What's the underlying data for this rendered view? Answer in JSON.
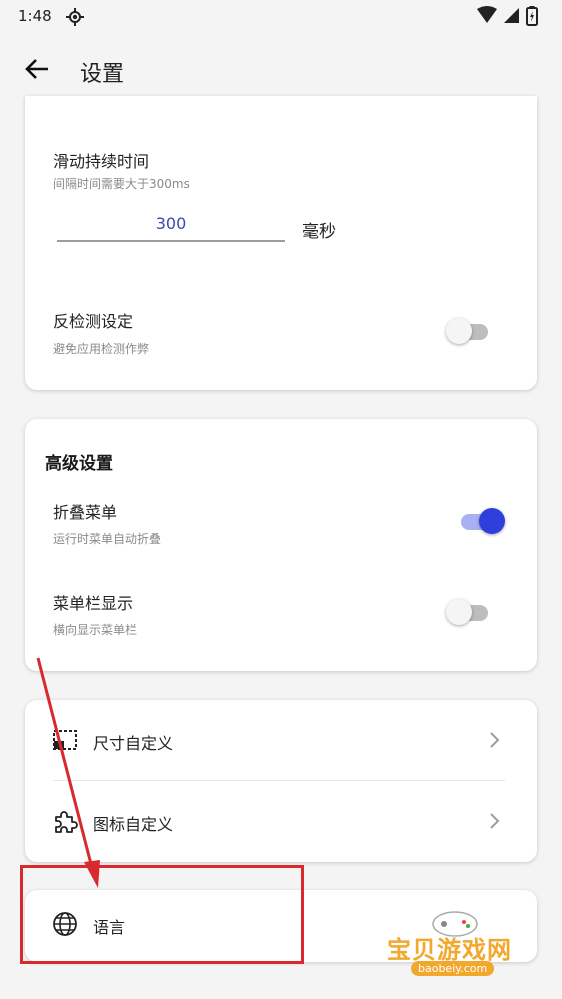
{
  "status_bar": {
    "time": "1:48"
  },
  "app_bar": {
    "title": "设置",
    "back_icon": "arrow-left-icon"
  },
  "swipe_duration": {
    "title": "滑动持续时间",
    "subtitle": "间隔时间需要大于300ms",
    "value": "300",
    "unit": "毫秒"
  },
  "anti_detect": {
    "title": "反检测设定",
    "subtitle": "避免应用检测作弊",
    "enabled": false
  },
  "advanced": {
    "section_title": "高级设置",
    "fold_menu": {
      "title": "折叠菜单",
      "subtitle": "运行时菜单自动折叠",
      "enabled": true
    },
    "menu_bar": {
      "title": "菜单栏显示",
      "subtitle": "横向显示菜单栏",
      "enabled": false
    }
  },
  "nav": {
    "size_custom": {
      "label": "尺寸自定义",
      "icon": "crop-icon"
    },
    "icon_custom": {
      "label": "图标自定义",
      "icon": "puzzle-icon"
    },
    "language": {
      "label": "语言",
      "icon": "globe-icon"
    }
  },
  "colors": {
    "accent": "#2f3fdd",
    "annotation": "#d9292d",
    "watermark": "#f2a82c"
  },
  "watermark": {
    "text": "宝贝游戏网",
    "url": "baobeiy.com"
  }
}
